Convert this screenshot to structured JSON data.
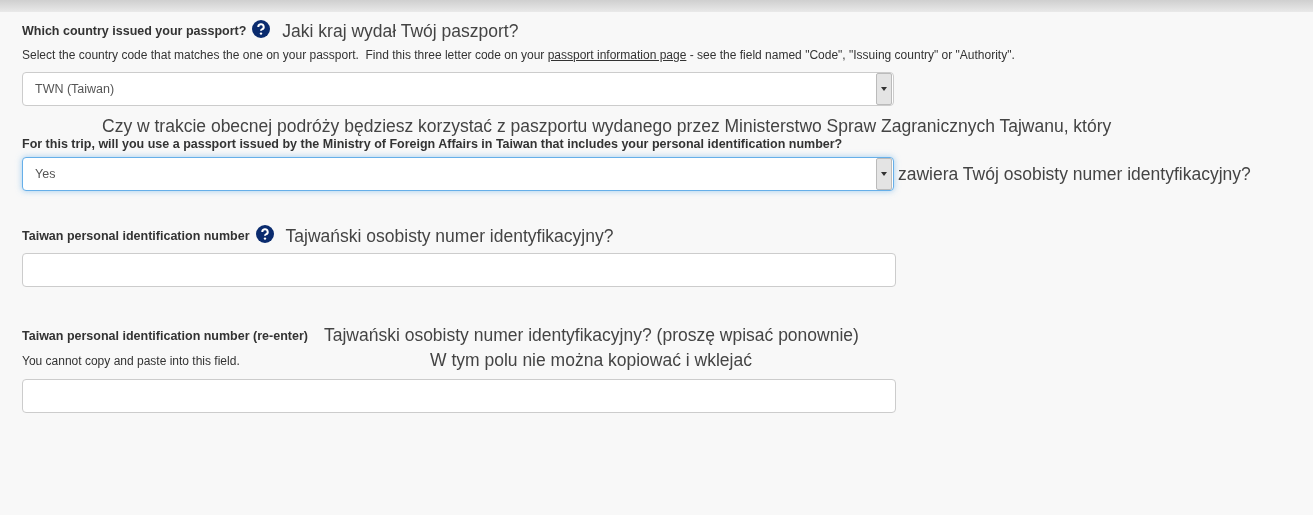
{
  "questions": [
    {
      "kind": "select",
      "label": "Which country issued your passport?",
      "help": true,
      "translation": "Jaki kraj wydał Twój paszport?",
      "hint": {
        "before": "Select the country code that matches the one on your passport.  Find this three letter code on your ",
        "link": "passport information page",
        "after": " - see the field named \"Code\", \"Issuing country\" or \"Authority\"."
      },
      "value": "TWN (Taiwan)",
      "focused": false
    },
    {
      "kind": "select",
      "translation_above": "Czy w trakcie obecnej podróży będziesz korzystać z paszportu wydanego przez Ministerstwo Spraw Zagranicznych Tajwanu, który",
      "label": "For this trip, will you use a passport issued by the Ministry of Foreign Affairs in Taiwan that includes your personal identification number?",
      "help": false,
      "value": "Yes",
      "focused": true,
      "translation_side": "zawiera Twój osobisty numer identyfikacyjny?"
    },
    {
      "kind": "text",
      "label": "Taiwan personal identification number",
      "help": true,
      "translation": "Tajwański osobisty numer identyfikacyjny?",
      "focused": false
    },
    {
      "kind": "text",
      "label": "Taiwan personal identification number (re-enter)",
      "help": false,
      "translation": "Tajwański osobisty numer identyfikacyjny? (proszę wpisać ponownie)",
      "hint": {
        "before": "You cannot copy and paste into this field."
      },
      "hint_translation": "W tym polu nie można kopiować i wklejać",
      "focused": false
    }
  ]
}
